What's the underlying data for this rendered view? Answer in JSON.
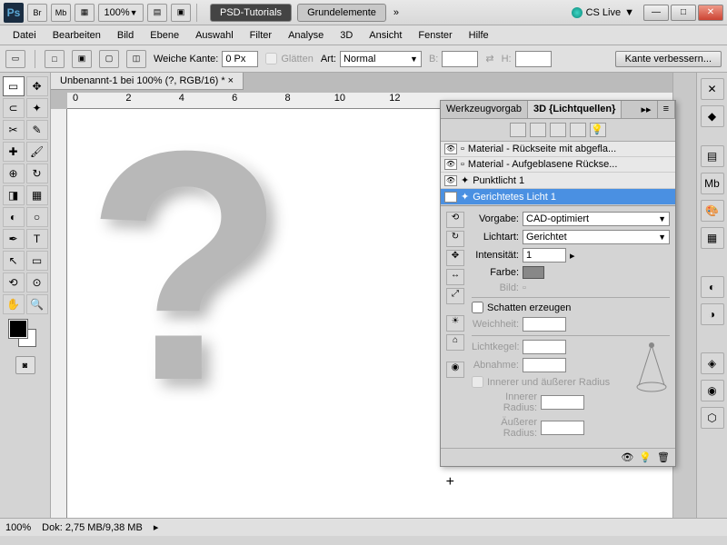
{
  "titlebar": {
    "zoom": "100%",
    "tab1": "PSD-Tutorials",
    "tab2": "Grundelemente",
    "cslive": "CS Live"
  },
  "menubar": [
    "Datei",
    "Bearbeiten",
    "Bild",
    "Ebene",
    "Auswahl",
    "Filter",
    "Analyse",
    "3D",
    "Ansicht",
    "Fenster",
    "Hilfe"
  ],
  "optbar": {
    "weiche_kante": "Weiche Kante:",
    "weiche_kante_val": "0 Px",
    "glaetten": "Glätten",
    "art": "Art:",
    "art_val": "Normal",
    "b": "B:",
    "h": "H:",
    "kante": "Kante verbessern..."
  },
  "doctab": "Unbenannt-1 bei 100% (?, RGB/16) *",
  "ruler_marks": [
    "0",
    "",
    "2",
    "",
    "4",
    "",
    "6",
    "",
    "8",
    "",
    "10",
    "",
    "12"
  ],
  "panel": {
    "tab1": "Werkzeugvorgab",
    "tab2": "3D {Lichtquellen}",
    "layers": [
      "Material - Rückseite mit abgefla...",
      "Material - Aufgeblasene Rückse...",
      "Punktlicht 1",
      "Gerichtetes Licht 1"
    ],
    "vorgabe": "Vorgabe:",
    "vorgabe_val": "CAD-optimiert",
    "lichtart": "Lichtart:",
    "lichtart_val": "Gerichtet",
    "intensitaet": "Intensität:",
    "intensitaet_val": "1",
    "farbe": "Farbe:",
    "bild": "Bild:",
    "schatten": "Schatten erzeugen",
    "weichheit": "Weichheit:",
    "lichtkegel": "Lichtkegel:",
    "abnahme": "Abnahme:",
    "innerer_ext": "Innerer und äußerer Radius",
    "innerer_r": "Innerer Radius:",
    "aeusserer_r": "Äußerer Radius:"
  },
  "status": {
    "zoom": "100%",
    "dok": "Dok: 2,75 MB/9,38 MB"
  }
}
